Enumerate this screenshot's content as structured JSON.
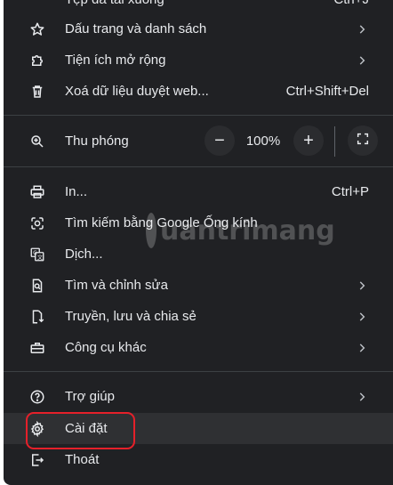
{
  "menu": {
    "top_item": {
      "label": "Tệp đã tải xuống",
      "shortcut": "Ctrl+J"
    },
    "bookmarks": {
      "label": "Dấu trang và danh sách",
      "icon": "star-icon"
    },
    "extensions": {
      "label": "Tiện ích mở rộng",
      "icon": "puzzle-icon"
    },
    "clear_data": {
      "label": "Xoá dữ liệu duyệt web...",
      "shortcut": "Ctrl+Shift+Del",
      "icon": "trash-icon"
    },
    "zoom": {
      "label": "Thu phóng",
      "value": "100%",
      "minus": "−",
      "plus": "+",
      "icon": "zoom-icon"
    },
    "print": {
      "label": "In...",
      "shortcut": "Ctrl+P",
      "icon": "print-icon"
    },
    "lens": {
      "label": "Tìm kiếm bằng Google Ống kính",
      "icon": "lens-icon"
    },
    "translate": {
      "label": "Dịch...",
      "icon": "translate-icon"
    },
    "find_edit": {
      "label": "Tìm và chỉnh sửa",
      "icon": "find-icon"
    },
    "cast_save": {
      "label": "Truyền, lưu và chia sẻ",
      "icon": "cast-save-icon"
    },
    "more_tools": {
      "label": "Công cụ khác",
      "icon": "toolbox-icon"
    },
    "help": {
      "label": "Trợ giúp",
      "icon": "help-icon"
    },
    "settings": {
      "label": "Cài đặt",
      "icon": "gear-icon"
    },
    "exit": {
      "label": "Thoát",
      "icon": "exit-icon"
    }
  },
  "watermark": {
    "text": "uantrimang"
  },
  "colors": {
    "menu_bg": "#202124",
    "text": "#e8eaed",
    "separator": "#3c4043",
    "highlight_border": "#e5202a",
    "hover_bg": "#2f3033"
  }
}
